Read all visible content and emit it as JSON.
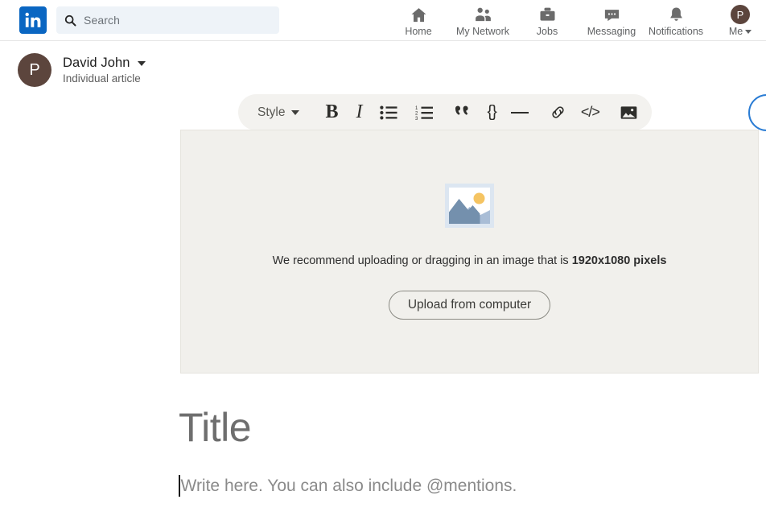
{
  "brand": {
    "logo_name": "linkedin-logo",
    "logo_color": "#0A66C2",
    "logo_text": "in"
  },
  "global_nav": {
    "search": {
      "placeholder": "Search",
      "value": "",
      "icon": "search-icon"
    },
    "items": [
      {
        "label": "Home",
        "icon": "home-icon"
      },
      {
        "label": "My Network",
        "icon": "people-icon"
      },
      {
        "label": "Jobs",
        "icon": "briefcase-icon"
      },
      {
        "label": "Messaging",
        "icon": "message-bubble-icon"
      },
      {
        "label": "Notifications",
        "icon": "bell-icon"
      },
      {
        "label": "Me",
        "icon": "avatar-icon",
        "avatar_initial": "P",
        "has_caret": true
      }
    ]
  },
  "editor_header": {
    "author": {
      "avatar_initial": "P",
      "avatar_color": "#5C453D",
      "name": "David John",
      "subtitle": "Individual article"
    },
    "toolbar": {
      "style_label": "Style",
      "buttons": [
        {
          "name": "bold-button",
          "glyph": "B"
        },
        {
          "name": "italic-button",
          "glyph": "I"
        },
        {
          "name": "bulleted-list-button",
          "glyph": "bulleted-list-icon"
        },
        {
          "name": "numbered-list-button",
          "glyph": "numbered-list-icon"
        },
        {
          "name": "quote-button",
          "glyph": "””"
        },
        {
          "name": "code-block-button",
          "glyph": "{}"
        },
        {
          "name": "horizontal-rule-button",
          "glyph": "—"
        },
        {
          "name": "link-button",
          "glyph": "link-icon"
        },
        {
          "name": "embed-button",
          "glyph": "</>"
        },
        {
          "name": "insert-image-button",
          "glyph": "image-icon"
        }
      ]
    }
  },
  "article": {
    "cover": {
      "placeholder_icon": "image-placeholder-icon",
      "recommend_text_before": "We recommend uploading or dragging in an image that is ",
      "recommend_dimensions": "1920x1080 pixels",
      "upload_button_label": "Upload from computer"
    },
    "title_placeholder": "Title",
    "body_placeholder": "Write here. You can also include @mentions."
  },
  "colors": {
    "linkedin_blue": "#0A66C2",
    "cover_background": "#F1F0EC",
    "toolbar_background": "#F3F2EF",
    "search_background": "#EEF3F8"
  }
}
